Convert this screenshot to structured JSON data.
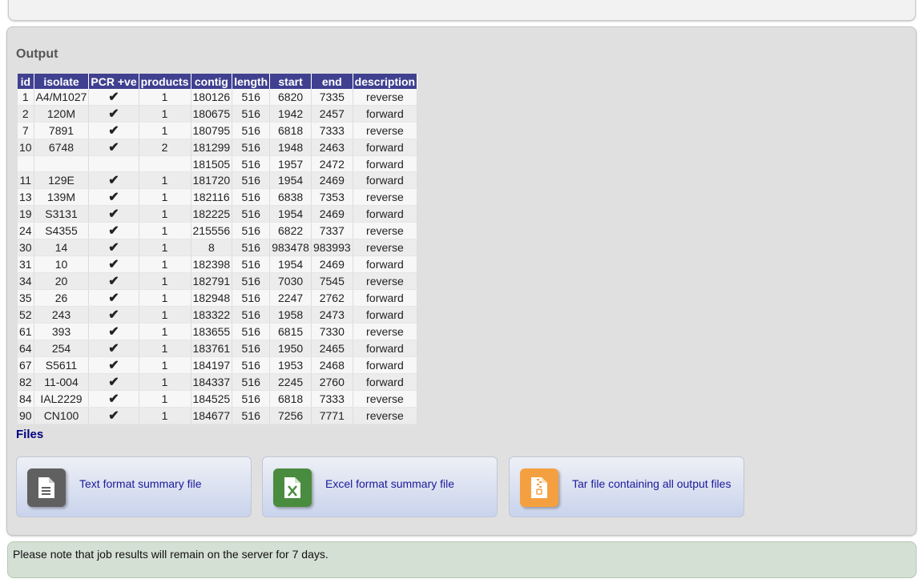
{
  "output": {
    "title": "Output",
    "columns": [
      "id",
      "isolate",
      "PCR +ve",
      "products",
      "contig",
      "length",
      "start",
      "end",
      "description"
    ],
    "rows": [
      {
        "id": "1",
        "isolate": "A4/M1027",
        "pcr": "✔",
        "products": "1",
        "contig": "180126",
        "length": "516",
        "start": "6820",
        "end": "7335",
        "description": "reverse"
      },
      {
        "id": "2",
        "isolate": "120M",
        "pcr": "✔",
        "products": "1",
        "contig": "180675",
        "length": "516",
        "start": "1942",
        "end": "2457",
        "description": "forward"
      },
      {
        "id": "7",
        "isolate": "7891",
        "pcr": "✔",
        "products": "1",
        "contig": "180795",
        "length": "516",
        "start": "6818",
        "end": "7333",
        "description": "reverse"
      },
      {
        "id": "10",
        "isolate": "6748",
        "pcr": "✔",
        "products": "2",
        "contig": "181299",
        "length": "516",
        "start": "1948",
        "end": "2463",
        "description": "forward"
      },
      {
        "id": "",
        "isolate": "",
        "pcr": "",
        "products": "",
        "contig": "181505",
        "length": "516",
        "start": "1957",
        "end": "2472",
        "description": "forward"
      },
      {
        "id": "11",
        "isolate": "129E",
        "pcr": "✔",
        "products": "1",
        "contig": "181720",
        "length": "516",
        "start": "1954",
        "end": "2469",
        "description": "forward"
      },
      {
        "id": "13",
        "isolate": "139M",
        "pcr": "✔",
        "products": "1",
        "contig": "182116",
        "length": "516",
        "start": "6838",
        "end": "7353",
        "description": "reverse"
      },
      {
        "id": "19",
        "isolate": "S3131",
        "pcr": "✔",
        "products": "1",
        "contig": "182225",
        "length": "516",
        "start": "1954",
        "end": "2469",
        "description": "forward"
      },
      {
        "id": "24",
        "isolate": "S4355",
        "pcr": "✔",
        "products": "1",
        "contig": "215556",
        "length": "516",
        "start": "6822",
        "end": "7337",
        "description": "reverse"
      },
      {
        "id": "30",
        "isolate": "14",
        "pcr": "✔",
        "products": "1",
        "contig": "8",
        "length": "516",
        "start": "983478",
        "end": "983993",
        "description": "reverse"
      },
      {
        "id": "31",
        "isolate": "10",
        "pcr": "✔",
        "products": "1",
        "contig": "182398",
        "length": "516",
        "start": "1954",
        "end": "2469",
        "description": "forward"
      },
      {
        "id": "34",
        "isolate": "20",
        "pcr": "✔",
        "products": "1",
        "contig": "182791",
        "length": "516",
        "start": "7030",
        "end": "7545",
        "description": "reverse"
      },
      {
        "id": "35",
        "isolate": "26",
        "pcr": "✔",
        "products": "1",
        "contig": "182948",
        "length": "516",
        "start": "2247",
        "end": "2762",
        "description": "forward"
      },
      {
        "id": "52",
        "isolate": "243",
        "pcr": "✔",
        "products": "1",
        "contig": "183322",
        "length": "516",
        "start": "1958",
        "end": "2473",
        "description": "forward"
      },
      {
        "id": "61",
        "isolate": "393",
        "pcr": "✔",
        "products": "1",
        "contig": "183655",
        "length": "516",
        "start": "6815",
        "end": "7330",
        "description": "reverse"
      },
      {
        "id": "64",
        "isolate": "254",
        "pcr": "✔",
        "products": "1",
        "contig": "183761",
        "length": "516",
        "start": "1950",
        "end": "2465",
        "description": "forward"
      },
      {
        "id": "67",
        "isolate": "S5611",
        "pcr": "✔",
        "products": "1",
        "contig": "184197",
        "length": "516",
        "start": "1953",
        "end": "2468",
        "description": "forward"
      },
      {
        "id": "82",
        "isolate": "11-004",
        "pcr": "✔",
        "products": "1",
        "contig": "184337",
        "length": "516",
        "start": "2245",
        "end": "2760",
        "description": "forward"
      },
      {
        "id": "84",
        "isolate": "IAL2229",
        "pcr": "✔",
        "products": "1",
        "contig": "184525",
        "length": "516",
        "start": "6818",
        "end": "7333",
        "description": "reverse"
      },
      {
        "id": "90",
        "isolate": "CN100",
        "pcr": "✔",
        "products": "1",
        "contig": "184677",
        "length": "516",
        "start": "7256",
        "end": "7771",
        "description": "reverse"
      }
    ]
  },
  "files": {
    "title": "Files",
    "items": [
      {
        "label": "Text format summary file",
        "icon": "text-file-icon",
        "color": "#606060"
      },
      {
        "label": "Excel format summary file",
        "icon": "excel-file-icon",
        "color": "#4a8c3f"
      },
      {
        "label": "Tar file containing all output files",
        "icon": "archive-file-icon",
        "color": "#f5a040"
      }
    ]
  },
  "notice": "Please note that job results will remain on the server for 7 days.",
  "colors": {
    "header_bg": "#404090",
    "check": "#1a8a1a",
    "files_title": "#000080",
    "link": "#1a1a99"
  }
}
